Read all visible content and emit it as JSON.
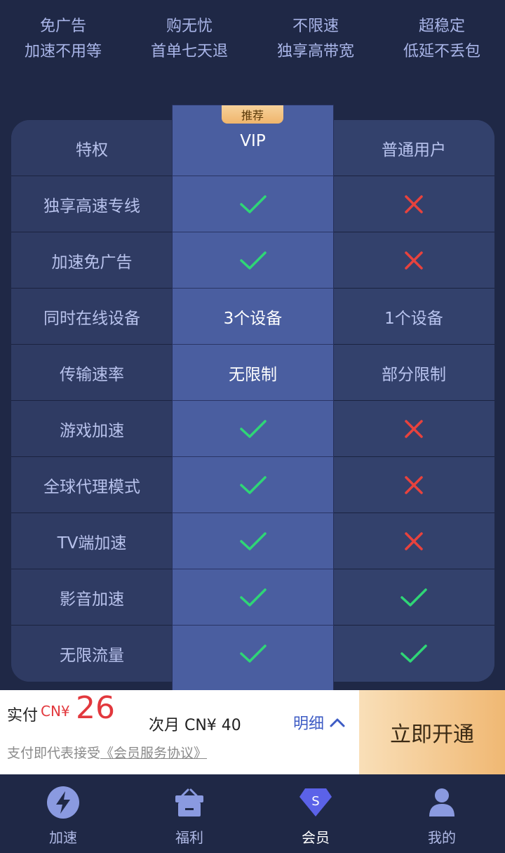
{
  "features": [
    {
      "line1": "免广告",
      "line2": "加速不用等"
    },
    {
      "line1": "购无忧",
      "line2": "首单七天退"
    },
    {
      "line1": "不限速",
      "line2": "独享高带宽"
    },
    {
      "line1": "超稳定",
      "line2": "低延不丢包"
    }
  ],
  "table": {
    "badge": "推荐",
    "headers": {
      "privilege": "特权",
      "vip": "VIP",
      "normal": "普通用户"
    },
    "rows": [
      {
        "label": "独享高速专线",
        "vip": "check",
        "normal": "cross"
      },
      {
        "label": "加速免广告",
        "vip": "check",
        "normal": "cross"
      },
      {
        "label": "同时在线设备",
        "vip": "3个设备",
        "normal": "1个设备"
      },
      {
        "label": "传输速率",
        "vip": "无限制",
        "normal": "部分限制"
      },
      {
        "label": "游戏加速",
        "vip": "check",
        "normal": "cross"
      },
      {
        "label": "全球代理模式",
        "vip": "check",
        "normal": "cross"
      },
      {
        "label": "TV端加速",
        "vip": "check",
        "normal": "cross"
      },
      {
        "label": "影音加速",
        "vip": "check",
        "normal": "check"
      },
      {
        "label": "无限流量",
        "vip": "check",
        "normal": "check"
      }
    ]
  },
  "pay": {
    "label": "实付",
    "currency": "CN¥",
    "amount": "26",
    "next_month": "次月 CN¥ 40",
    "detail": "明细",
    "agree_prefix": "支付即代表接受",
    "agree_link": "《会员服务协议》",
    "button": "立即开通"
  },
  "nav": [
    {
      "label": "加速",
      "icon": "lightning-icon"
    },
    {
      "label": "福利",
      "icon": "gift-icon"
    },
    {
      "label": "会员",
      "icon": "vip-diamond-icon"
    },
    {
      "label": "我的",
      "icon": "user-icon"
    }
  ],
  "colors": {
    "check": "#2fd676",
    "cross": "#e8423d",
    "accent": "#3d5bc4",
    "price": "#e2383d"
  }
}
